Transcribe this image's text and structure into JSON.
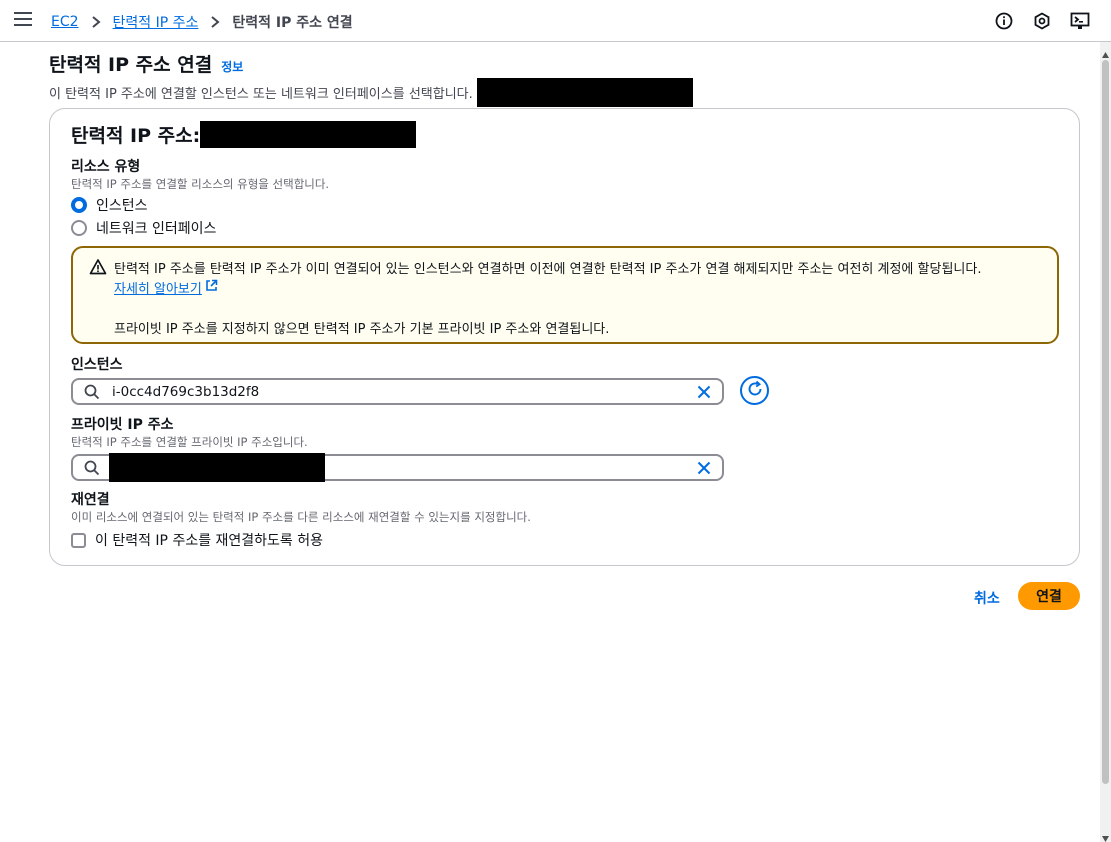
{
  "breadcrumb": {
    "items": [
      "EC2",
      "탄력적 IP 주소"
    ],
    "current": "탄력적 IP 주소 연결"
  },
  "header": {
    "title": "탄력적 IP 주소 연결",
    "info_link": "정보",
    "description": "이 탄력적 IP 주소에 연결할 인스턴스 또는 네트워크 인터페이스를 선택합니다."
  },
  "card": {
    "title_prefix": "탄력적 IP 주소: "
  },
  "resource_type": {
    "label": "리소스 유형",
    "description": "탄력적 IP 주소를 연결할 리소스의 유형을 선택합니다.",
    "options": [
      "인스턴스",
      "네트워크 인터페이스"
    ],
    "selected": "인스턴스"
  },
  "alert": {
    "line1": "탄력적 IP 주소를 탄력적 IP 주소가 이미 연결되어 있는 인스턴스와 연결하면 이전에 연결한 탄력적 IP 주소가 연결 해제되지만 주소는 여전히 계정에 할당됩니다.",
    "link": "자세히 알아보기",
    "line2": "프라이빗 IP 주소를 지정하지 않으면 탄력적 IP 주소가 기본 프라이빗 IP 주소와 연결됩니다."
  },
  "instance": {
    "label": "인스턴스",
    "value": "i-0cc4d769c3b13d2f8"
  },
  "private_ip": {
    "label": "프라이빗 IP 주소",
    "description": "탄력적 IP 주소를 연결할 프라이빗 IP 주소입니다."
  },
  "reassociate": {
    "label": "재연결",
    "description": "이미 리소스에 연결되어 있는 탄력적 IP 주소를 다른 리소스에 재연결할 수 있는지를 지정합니다.",
    "checkbox_label": "이 탄력적 IP 주소를 재연결하도록 허용",
    "checked": false
  },
  "actions": {
    "cancel": "취소",
    "submit": "연결"
  },
  "colors": {
    "link": "#006ce0",
    "primary": "#ff9900",
    "warning_border": "#8d6605",
    "warning_bg": "#fffef0"
  },
  "icons": [
    "menu-icon",
    "chevron-right-icon",
    "info-icon",
    "settings-icon",
    "cloudshell-icon",
    "warning-icon",
    "external-link-icon",
    "search-icon",
    "clear-icon",
    "refresh-icon"
  ]
}
